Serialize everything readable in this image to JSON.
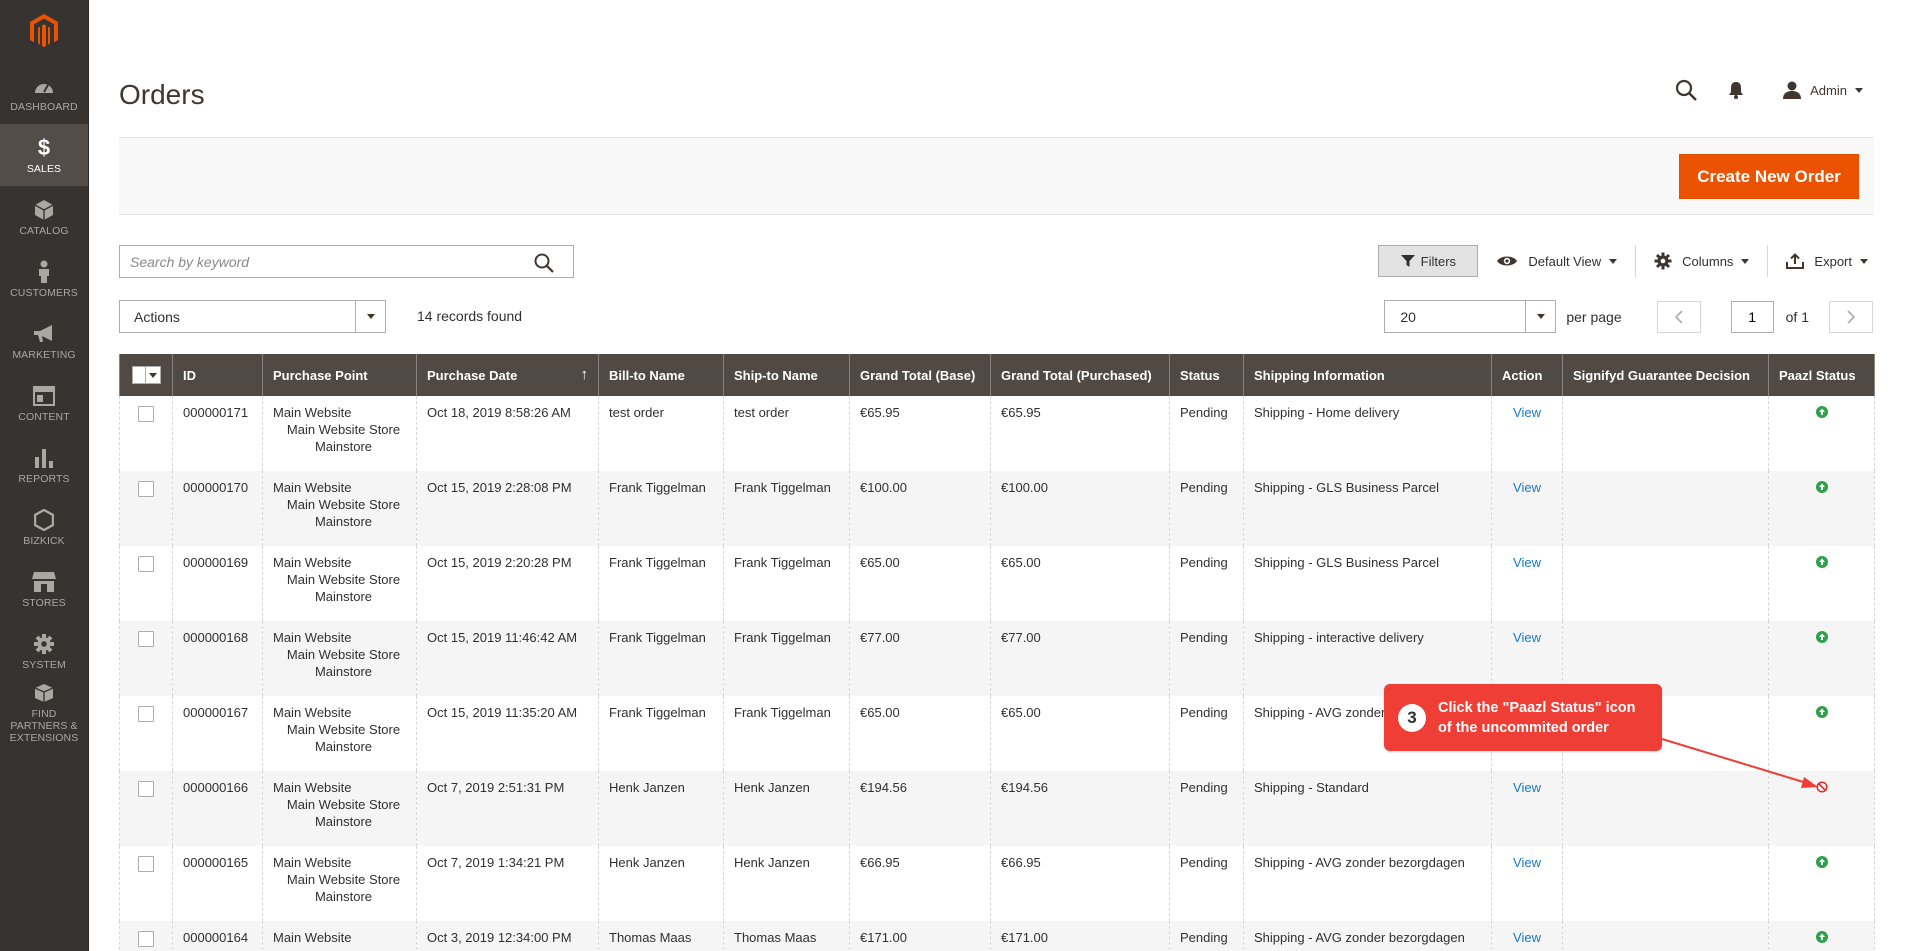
{
  "sidebar": {
    "items": [
      {
        "label": "DASHBOARD",
        "icon": "dashboard-icon"
      },
      {
        "label": "SALES",
        "icon": "dollar-icon",
        "active": true
      },
      {
        "label": "CATALOG",
        "icon": "box-icon"
      },
      {
        "label": "CUSTOMERS",
        "icon": "person-icon"
      },
      {
        "label": "MARKETING",
        "icon": "megaphone-icon"
      },
      {
        "label": "CONTENT",
        "icon": "layout-icon"
      },
      {
        "label": "REPORTS",
        "icon": "bar-chart-icon"
      },
      {
        "label": "BIZKICK",
        "icon": "hexagon-icon"
      },
      {
        "label": "STORES",
        "icon": "store-icon"
      },
      {
        "label": "SYSTEM",
        "icon": "gear-icon"
      },
      {
        "label": "FIND PARTNERS & EXTENSIONS",
        "icon": "boxes-icon"
      }
    ]
  },
  "header": {
    "title": "Orders",
    "user": "Admin"
  },
  "action_bar": {
    "create_label": "Create New Order"
  },
  "search": {
    "placeholder": "Search by keyword"
  },
  "toolbar": {
    "filters_label": "Filters",
    "view_label": "Default View",
    "columns_label": "Columns",
    "export_label": "Export"
  },
  "mass_actions": {
    "label": "Actions",
    "records": "14 records found"
  },
  "pager": {
    "per_page_value": "20",
    "per_page_label": "per page",
    "current_page": "1",
    "of_label": "of 1"
  },
  "grid": {
    "columns": [
      "ID",
      "Purchase Point",
      "Purchase Date",
      "Bill-to Name",
      "Ship-to Name",
      "Grand Total (Base)",
      "Grand Total (Purchased)",
      "Status",
      "Shipping Information",
      "Action",
      "Signifyd Guarantee Decision",
      "Paazl Status"
    ],
    "sort_indicator": "↑",
    "rows": [
      {
        "id": "000000171",
        "pp1": "Main Website",
        "pp2": "Main Website Store",
        "pp3": "Mainstore",
        "date": "Oct 18, 2019 8:58:26 AM",
        "bill": "test order",
        "ship": "test order",
        "base": "€65.95",
        "purchased": "€65.95",
        "status": "Pending",
        "shipping": "Shipping - Home delivery",
        "action": "View",
        "signifyd": "",
        "paazl": "ok"
      },
      {
        "id": "000000170",
        "pp1": "Main Website",
        "pp2": "Main Website Store",
        "pp3": "Mainstore",
        "date": "Oct 15, 2019 2:28:08 PM",
        "bill": "Frank Tiggelman",
        "ship": "Frank Tiggelman",
        "base": "€100.00",
        "purchased": "€100.00",
        "status": "Pending",
        "shipping": "Shipping - GLS Business Parcel",
        "action": "View",
        "signifyd": "",
        "paazl": "ok"
      },
      {
        "id": "000000169",
        "pp1": "Main Website",
        "pp2": "Main Website Store",
        "pp3": "Mainstore",
        "date": "Oct 15, 2019 2:20:28 PM",
        "bill": "Frank Tiggelman",
        "ship": "Frank Tiggelman",
        "base": "€65.00",
        "purchased": "€65.00",
        "status": "Pending",
        "shipping": "Shipping - GLS Business Parcel",
        "action": "View",
        "signifyd": "",
        "paazl": "ok"
      },
      {
        "id": "000000168",
        "pp1": "Main Website",
        "pp2": "Main Website Store",
        "pp3": "Mainstore",
        "date": "Oct 15, 2019 11:46:42 AM",
        "bill": "Frank Tiggelman",
        "ship": "Frank Tiggelman",
        "base": "€77.00",
        "purchased": "€77.00",
        "status": "Pending",
        "shipping": "Shipping - interactive delivery",
        "action": "View",
        "signifyd": "",
        "paazl": "ok"
      },
      {
        "id": "000000167",
        "pp1": "Main Website",
        "pp2": "Main Website Store",
        "pp3": "Mainstore",
        "date": "Oct 15, 2019 11:35:20 AM",
        "bill": "Frank Tiggelman",
        "ship": "Frank Tiggelman",
        "base": "€65.00",
        "purchased": "€65.00",
        "status": "Pending",
        "shipping": "Shipping - AVG zonder",
        "action": "",
        "signifyd": "",
        "paazl": "ok"
      },
      {
        "id": "000000166",
        "pp1": "Main Website",
        "pp2": "Main Website Store",
        "pp3": "Mainstore",
        "date": "Oct 7, 2019 2:51:31 PM",
        "bill": "Henk Janzen",
        "ship": "Henk Janzen",
        "base": "€194.56",
        "purchased": "€194.56",
        "status": "Pending",
        "shipping": "Shipping - Standard",
        "action": "View",
        "signifyd": "",
        "paazl": "error"
      },
      {
        "id": "000000165",
        "pp1": "Main Website",
        "pp2": "Main Website Store",
        "pp3": "Mainstore",
        "date": "Oct 7, 2019 1:34:21 PM",
        "bill": "Henk Janzen",
        "ship": "Henk Janzen",
        "base": "€66.95",
        "purchased": "€66.95",
        "status": "Pending",
        "shipping": "Shipping - AVG zonder bezorgdagen",
        "action": "View",
        "signifyd": "",
        "paazl": "ok"
      },
      {
        "id": "000000164",
        "pp1": "Main Website",
        "pp2": "",
        "pp3": "",
        "date": "Oct 3, 2019 12:34:00 PM",
        "bill": "Thomas Maas",
        "ship": "Thomas Maas",
        "base": "€171.00",
        "purchased": "€171.00",
        "status": "Pending",
        "shipping": "Shipping - AVG zonder bezorgdagen",
        "action": "View",
        "signifyd": "",
        "paazl": "ok"
      }
    ]
  },
  "callout": {
    "number": "3",
    "line1": "Click the \"Paazl Status\" icon",
    "line2": "of the uncommited order",
    "color": "#ef3e35"
  },
  "colors": {
    "sidebar_bg": "#373330",
    "accent": "#eb5202",
    "grid_header": "#514943",
    "link": "#1979c3",
    "status_ok": "#2fa04b",
    "status_error": "#e02b27"
  }
}
